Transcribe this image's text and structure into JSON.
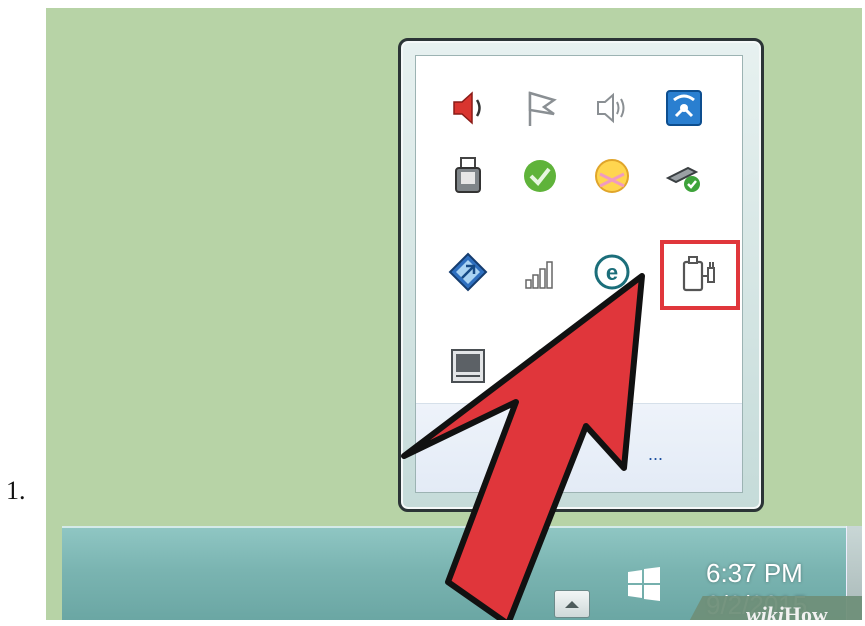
{
  "step": {
    "number": "1."
  },
  "tray_popup": {
    "icons": [
      "speaker-icon",
      "action-center-flag-icon",
      "speaker-muted-icon",
      "network-diagnostic-icon",
      "usb-device-icon",
      "green-update-icon",
      "yellow-smiley-icon",
      "safely-remove-hardware-icon",
      "blue-app-icon",
      "signal-bars-icon",
      "eset-icon",
      "power-plug-icon",
      "touchpad-icon",
      "gray-device-icon"
    ],
    "customize_link": "...",
    "highlighted_icon": "power-plug-icon"
  },
  "taskbar": {
    "clock_time": "6:37 PM",
    "clock_date": "9/2/2015"
  },
  "watermark": {
    "part1": "wiki",
    "part2": "How"
  },
  "colors": {
    "highlight": "#e0363b",
    "arrow": "#e0363b",
    "desktop": "#b7d3a6",
    "taskbar": "#7ab4b1"
  }
}
